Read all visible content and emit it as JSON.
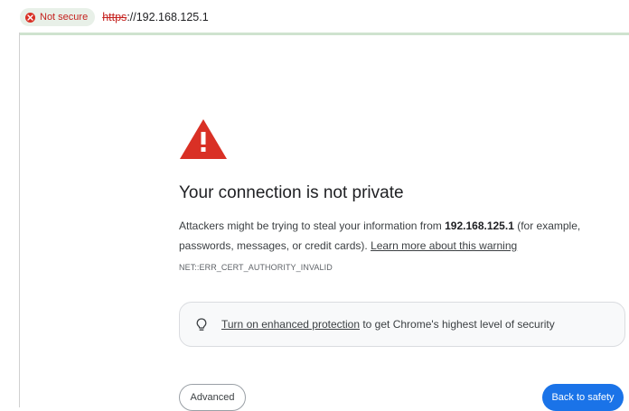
{
  "addressbar": {
    "security_label": "Not secure",
    "url_scheme": "https",
    "url_rest": "://192.168.125.1"
  },
  "page": {
    "title": "Your connection is not private",
    "desc_part1": "Attackers might be trying to steal your information from ",
    "desc_host": "192.168.125.1",
    "desc_part2": " (for example, passwords, messages, or credit cards). ",
    "learn_more_link": "Learn more about this warning",
    "error_code": "NET::ERR_CERT_AUTHORITY_INVALID",
    "protection_link": "Turn on enhanced protection",
    "protection_text": " to get Chrome's highest level of security",
    "advanced_button": "Advanced",
    "back_button": "Back to safety"
  },
  "colors": {
    "warning_red": "#d93025",
    "primary_blue": "#1a73e8",
    "not_secure_red": "#c5221f"
  },
  "icons": {
    "security": "not-secure-icon",
    "warning": "warning-triangle-icon",
    "protection": "lightbulb-icon"
  }
}
